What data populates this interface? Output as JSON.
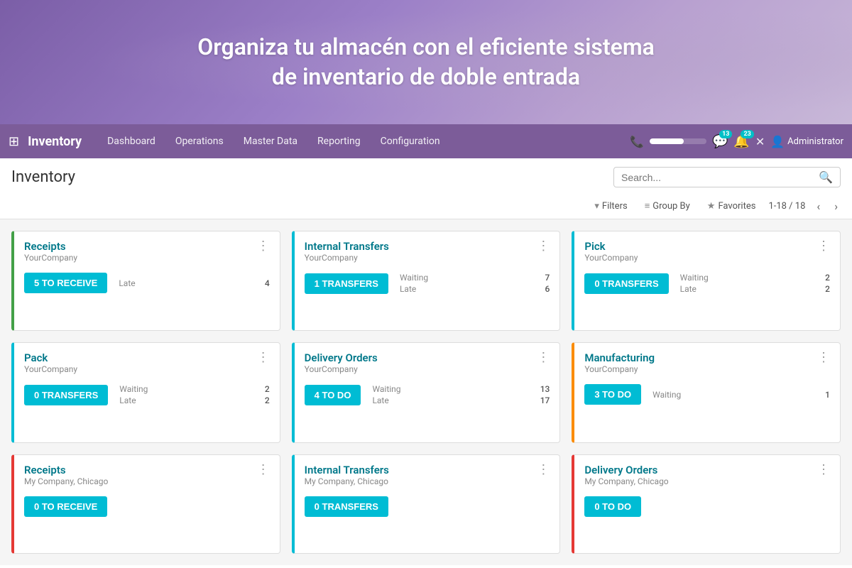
{
  "hero": {
    "text": "Organiza tu almacén con el eficiente sistema\nde inventario de doble entrada"
  },
  "navbar": {
    "brand": "Inventory",
    "links": [
      "Dashboard",
      "Operations",
      "Master Data",
      "Reporting",
      "Configuration"
    ],
    "badge1_count": "13",
    "badge2_count": "23",
    "user": "Administrator"
  },
  "page": {
    "title": "Inventory",
    "search_placeholder": "Search...",
    "toolbar": {
      "filters_label": "Filters",
      "groupby_label": "Group By",
      "favorites_label": "Favorites",
      "page_count": "1-18 / 18"
    }
  },
  "cards": [
    {
      "id": "receipts-yourcompany",
      "title": "Receipts",
      "subtitle": "YourCompany",
      "border": "green-border",
      "btn_label": "5 TO RECEIVE",
      "stats": [
        {
          "label": "Late",
          "value": "4"
        }
      ]
    },
    {
      "id": "internal-transfers-yourcompany",
      "title": "Internal Transfers",
      "subtitle": "YourCompany",
      "border": "blue-border",
      "btn_label": "1 TRANSFERS",
      "stats": [
        {
          "label": "Waiting",
          "value": "7"
        },
        {
          "label": "Late",
          "value": "6"
        }
      ]
    },
    {
      "id": "pick-yourcompany",
      "title": "Pick",
      "subtitle": "YourCompany",
      "border": "blue-border",
      "btn_label": "0 TRANSFERS",
      "stats": [
        {
          "label": "Waiting",
          "value": "2"
        },
        {
          "label": "Late",
          "value": "2"
        }
      ]
    },
    {
      "id": "pack-yourcompany",
      "title": "Pack",
      "subtitle": "YourCompany",
      "border": "blue-border",
      "btn_label": "0 TRANSFERS",
      "stats": [
        {
          "label": "Waiting",
          "value": "2"
        },
        {
          "label": "Late",
          "value": "2"
        }
      ]
    },
    {
      "id": "delivery-orders-yourcompany",
      "title": "Delivery Orders",
      "subtitle": "YourCompany",
      "border": "blue-border",
      "btn_label": "4 TO DO",
      "stats": [
        {
          "label": "Waiting",
          "value": "13"
        },
        {
          "label": "Late",
          "value": "17"
        }
      ]
    },
    {
      "id": "manufacturing-yourcompany",
      "title": "Manufacturing",
      "subtitle": "YourCompany",
      "border": "orange-border",
      "btn_label": "3 TO DO",
      "stats": [
        {
          "label": "Waiting",
          "value": "1"
        }
      ]
    },
    {
      "id": "receipts-chicago",
      "title": "Receipts",
      "subtitle": "My Company, Chicago",
      "border": "red-border",
      "btn_label": "0 TO RECEIVE",
      "stats": []
    },
    {
      "id": "internal-transfers-chicago",
      "title": "Internal Transfers",
      "subtitle": "My Company, Chicago",
      "border": "blue-border",
      "btn_label": "0 TRANSFERS",
      "stats": []
    },
    {
      "id": "delivery-orders-chicago",
      "title": "Delivery Orders",
      "subtitle": "My Company, Chicago",
      "border": "red-border",
      "btn_label": "0 TO DO",
      "stats": []
    }
  ]
}
